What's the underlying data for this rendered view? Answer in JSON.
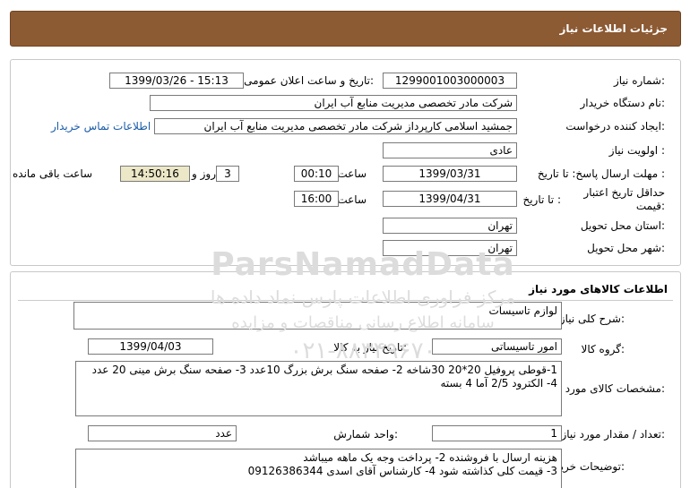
{
  "header": {
    "title": "جزئیات اطلاعات نیاز"
  },
  "need_info": {
    "need_number_label": "شماره نیاز:",
    "need_number": "1299001003000003",
    "announce_label": "تاریخ و ساعت اعلان عمومی:",
    "announce_value": "1399/03/26 - 15:13",
    "buyer_org_label": "نام دستگاه خریدار:",
    "buyer_org": "شرکت مادر تخصصی مدیریت منابع آب ایران",
    "creator_label": "ایجاد کننده درخواست:",
    "creator": "جمشید  اسلامی کارپرداز شرکت مادر تخصصی مدیریت منابع آب ایران",
    "contact_link": "اطلاعات تماس خریدار",
    "priority_label": "اولویت نیاز :",
    "priority": "عادی",
    "deadline_label": "مهلت ارسال پاسخ:  تا تاریخ :",
    "deadline_date": "1399/03/31",
    "time_label": "ساعت",
    "deadline_time": "00:10",
    "days": "3",
    "days_label": "روز و",
    "remaining_time": "14:50:16",
    "remaining_label": "ساعت باقی مانده",
    "validity_label": "حداقل تاریخ اعتبار قیمت:",
    "validity_to_label": "تا تاریخ :",
    "validity_date": "1399/04/31",
    "validity_time": "16:00",
    "province_label": "استان محل تحویل:",
    "province": "تهران",
    "city_label": "شهر محل تحویل:",
    "city": "تهران"
  },
  "watermark": {
    "line1": "ParsNamadData",
    "line2": "مرکز فراوری اطلاعات پارس نماد داده ها",
    "line3": "سامانه اطلاع رسانی مناقصات و مزایده",
    "line4": "۰۲۱-۸۸۳۴۹۶۷۰"
  },
  "goods": {
    "section_title": "اطلاعات کالاهای مورد نیاز",
    "general_desc_label": "شرح کلی نیاز:",
    "general_desc": "لوازم تاسیسات",
    "group_label": "گروه کالا:",
    "group": "امور تاسیساتی",
    "need_date_label": "تاریخ نیاز به کالا:",
    "need_date": "1399/04/03",
    "specs_label": "مشخصات کالای مورد نیاز:",
    "specs": "1-قوطی پروفیل 20*20  30شاخه  2- صفحه سنگ برش بزرگ 10عدد 3- صفحه سنگ برش مینی 20 عدد 4- الکترود 2/5 آما 4 بسته",
    "qty_label": "تعداد / مقدار مورد نیاز:",
    "qty": "1",
    "unit_label": "واحد شمارش:",
    "unit": "عدد",
    "buyer_notes_label": "توضیحات خریدار:",
    "buyer_notes_line1": "هزینه ارسال با فروشنده 2- پرداخت وجه یک ماهه میباشد",
    "buyer_notes_line2": "3- قیمت کلی کذاشته شود 4- کارشناس آقای اسدی 09126386344"
  }
}
